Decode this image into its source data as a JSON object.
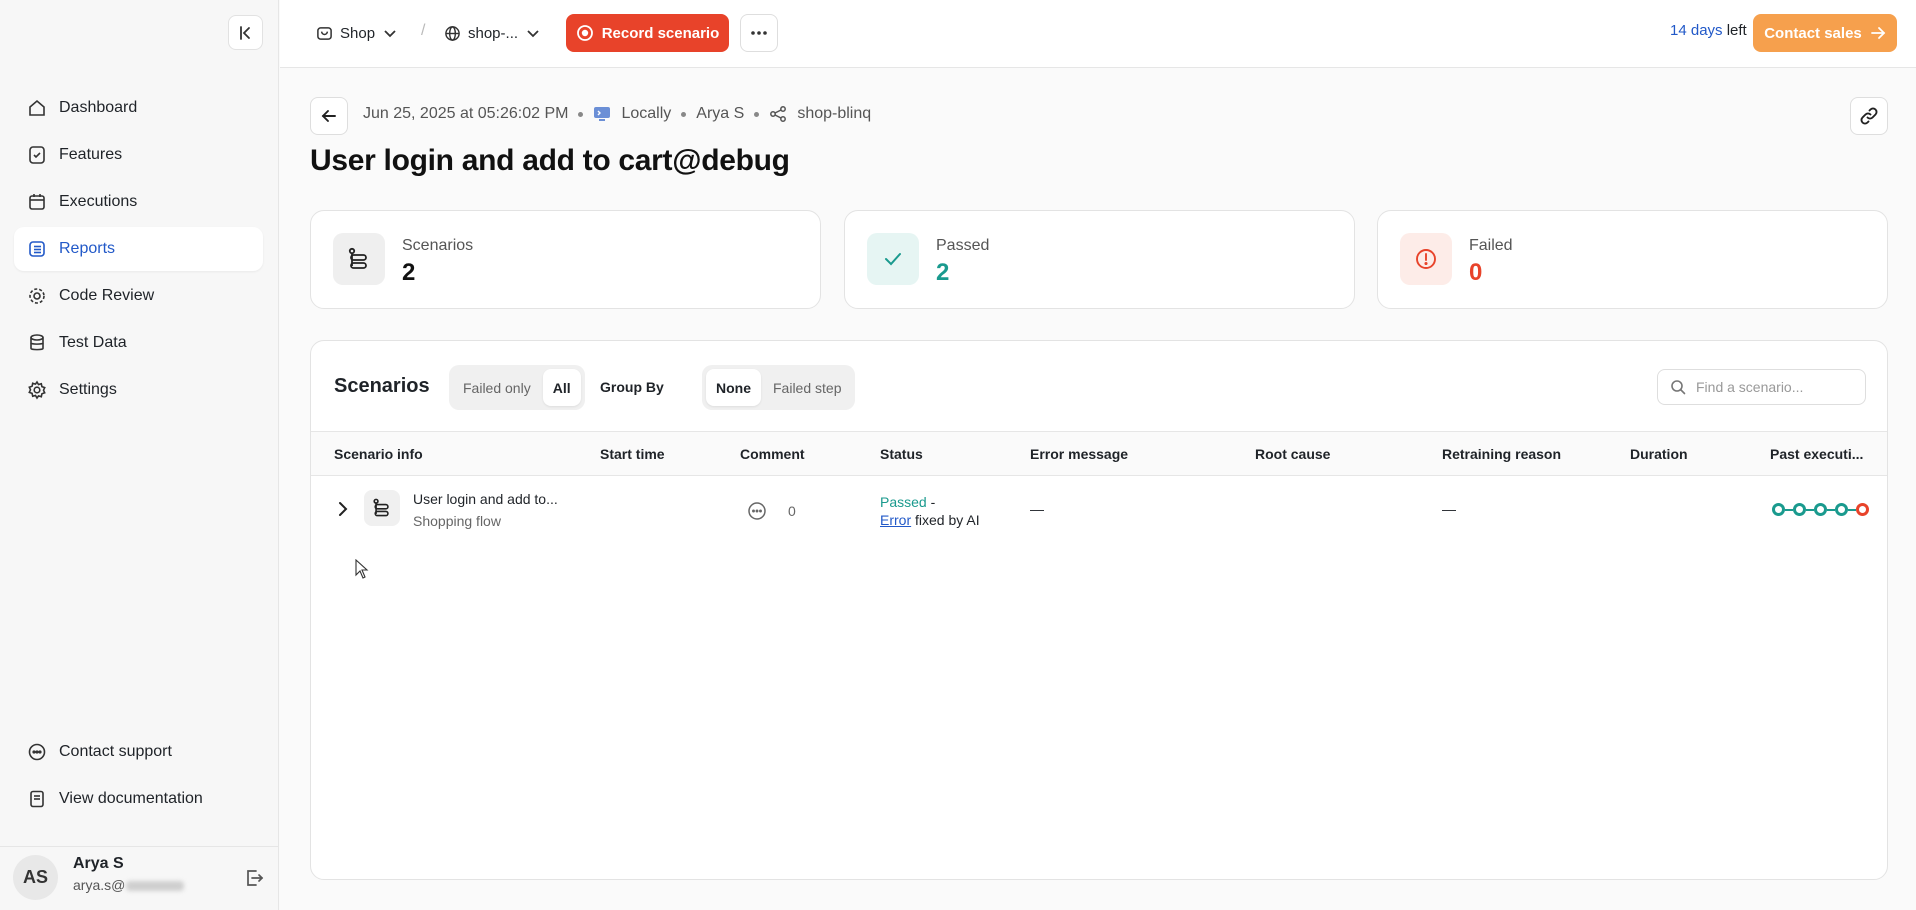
{
  "sidebar": {
    "items": [
      {
        "label": "Dashboard",
        "icon": "home-icon"
      },
      {
        "label": "Features",
        "icon": "feature-icon"
      },
      {
        "label": "Executions",
        "icon": "calendar-icon"
      },
      {
        "label": "Reports",
        "icon": "list-icon",
        "active": true
      },
      {
        "label": "Code Review",
        "icon": "gear-icon"
      },
      {
        "label": "Test Data",
        "icon": "database-icon"
      },
      {
        "label": "Settings",
        "icon": "settings-icon"
      }
    ],
    "bottom": [
      {
        "label": "Contact support",
        "icon": "chat-icon"
      },
      {
        "label": "View documentation",
        "icon": "doc-icon"
      }
    ],
    "user": {
      "initials": "AS",
      "name": "Arya S",
      "email_prefix": "arya.s@"
    }
  },
  "topbar": {
    "project": "Shop",
    "environment": "shop-...",
    "record_label": "Record scenario",
    "trial_days": "14 days",
    "trial_suffix": " left",
    "contact_label": "Contact sales"
  },
  "header": {
    "timestamp": "Jun 25, 2025 at 05:26:02 PM",
    "location": "Locally",
    "author": "Arya S",
    "branch": "shop-blinq",
    "title": "User login and add to cart@debug"
  },
  "stats": [
    {
      "label": "Scenarios",
      "value": "2",
      "color": "#111111"
    },
    {
      "label": "Passed",
      "value": "2",
      "color": "#1a9a8e"
    },
    {
      "label": "Failed",
      "value": "0",
      "color": "#e8432a"
    }
  ],
  "scenarios": {
    "title": "Scenarios",
    "filter": {
      "failed_only": "Failed only",
      "all": "All",
      "selected": "All"
    },
    "group_by_label": "Group By",
    "group": {
      "none": "None",
      "failed_step": "Failed step",
      "selected": "None"
    },
    "search_placeholder": "Find a scenario...",
    "columns": [
      "Scenario info",
      "Start time",
      "Comment",
      "Status",
      "Error message",
      "Root cause",
      "Retraining reason",
      "Duration",
      "Past executi..."
    ],
    "rows": [
      {
        "name": "User login and add to...",
        "subtitle": "Shopping flow",
        "comments": "0",
        "status_passed": "Passed",
        "status_sep": " -",
        "status_error": "Error",
        "status_fixed": " fixed by AI",
        "error_message": "—",
        "retraining_reason": "—",
        "past": [
          "pass",
          "pass",
          "pass",
          "pass",
          "fail"
        ]
      }
    ]
  }
}
